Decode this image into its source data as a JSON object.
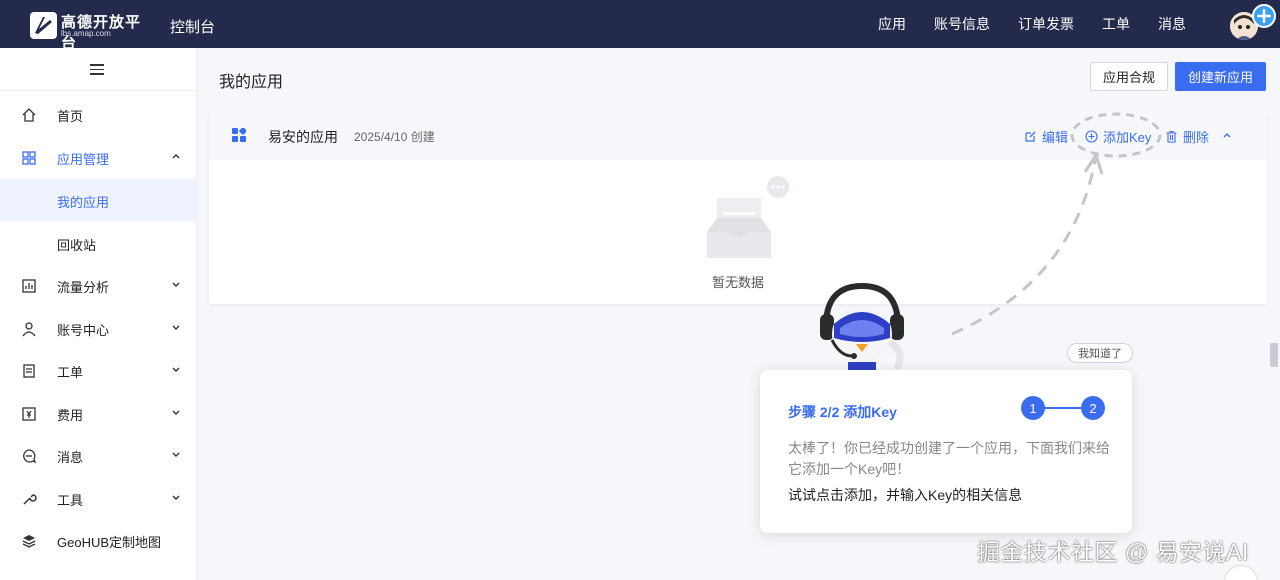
{
  "header": {
    "logo_name": "高德开放平台",
    "logo_sub": "lbs.amap.com",
    "console_title": "控制台",
    "nav": [
      "应用",
      "账号信息",
      "订单发票",
      "工单",
      "消息"
    ]
  },
  "sidebar": {
    "items": [
      {
        "label": "首页",
        "icon": "home-icon"
      },
      {
        "label": "应用管理",
        "icon": "apps-grid-icon",
        "expanded": true
      },
      {
        "label": "我的应用",
        "sub": true,
        "selected": true
      },
      {
        "label": "回收站",
        "sub": true
      },
      {
        "label": "流量分析",
        "icon": "chart-icon"
      },
      {
        "label": "账号中心",
        "icon": "user-icon"
      },
      {
        "label": "工单",
        "icon": "ticket-icon"
      },
      {
        "label": "费用",
        "icon": "money-icon"
      },
      {
        "label": "消息",
        "icon": "message-icon"
      },
      {
        "label": "工具",
        "icon": "wrench-icon"
      },
      {
        "label": "GeoHUB定制地图",
        "icon": "layers-icon"
      }
    ]
  },
  "main": {
    "title": "我的应用",
    "compliance_button": "应用合规",
    "create_button": "创建新应用"
  },
  "app_card": {
    "name": "易安的应用",
    "created": "2025/4/10 创建",
    "actions": {
      "edit": "编辑",
      "add_key": "添加Key",
      "delete": "删除"
    },
    "empty_text": "暂无数据"
  },
  "guide": {
    "dismiss": "我知道了",
    "title": "步骤 2/2 添加Key",
    "steps": [
      "1",
      "2"
    ],
    "body_line1": "太棒了！你已经成功创建了一个应用，下面我们来给它添加一个Key吧！",
    "body_line2": "试试点击添加，并输入Key的相关信息"
  },
  "watermark": "掘金技术社区 @ 易安说AI",
  "colors": {
    "header_bg": "#232a4b",
    "accent": "#3a6cf0",
    "page_bg": "#f6f7fa"
  }
}
